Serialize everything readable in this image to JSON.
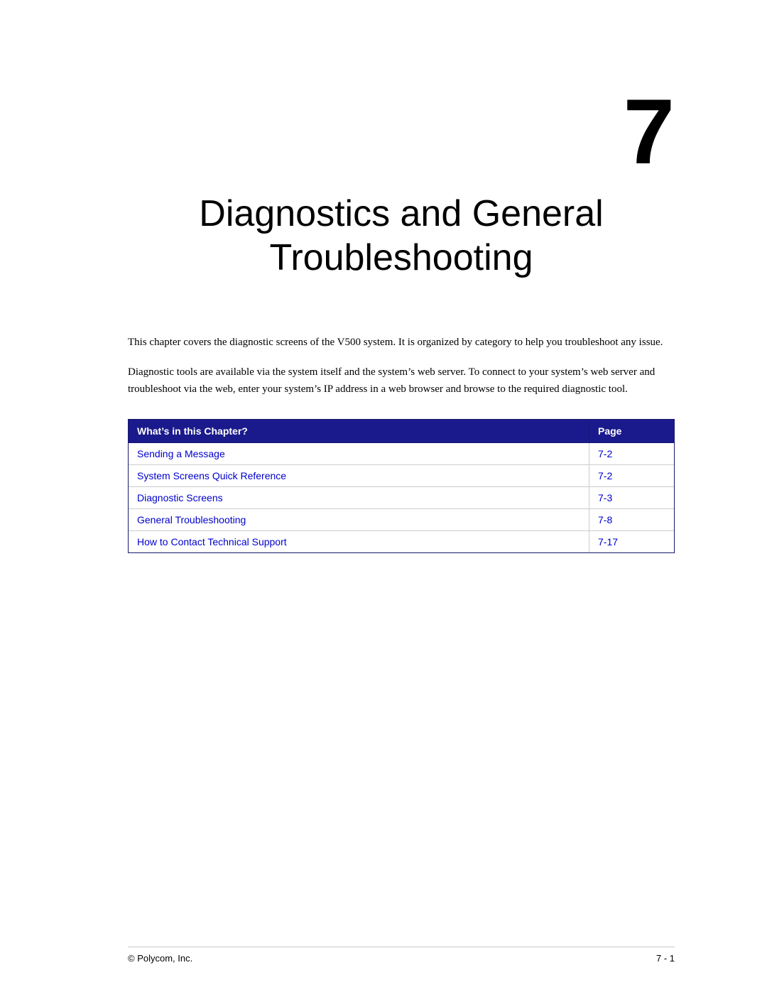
{
  "chapter": {
    "number": "7",
    "title_line1": "Diagnostics and General",
    "title_line2": "Troubleshooting"
  },
  "paragraphs": {
    "intro1": "This chapter covers the diagnostic screens of the V500 system. It is organized by category to help you troubleshoot any issue.",
    "intro2": "Diagnostic tools are available via the system itself and the system’s web server. To connect to your system’s web server and troubleshoot via the web, enter your system’s IP address in a web browser and browse to the required diagnostic tool."
  },
  "table": {
    "header_topic": "What’s in this Chapter?",
    "header_page": "Page",
    "rows": [
      {
        "topic": "Sending a Message",
        "page": "7-2"
      },
      {
        "topic": "System Screens Quick Reference",
        "page": "7-2"
      },
      {
        "topic": "Diagnostic Screens",
        "page": "7-3"
      },
      {
        "topic": "General Troubleshooting",
        "page": "7-8"
      },
      {
        "topic": "How to Contact Technical Support",
        "page": "7-17"
      }
    ]
  },
  "footer": {
    "copyright": "© Polycom, Inc.",
    "page_number": "7 - 1"
  }
}
